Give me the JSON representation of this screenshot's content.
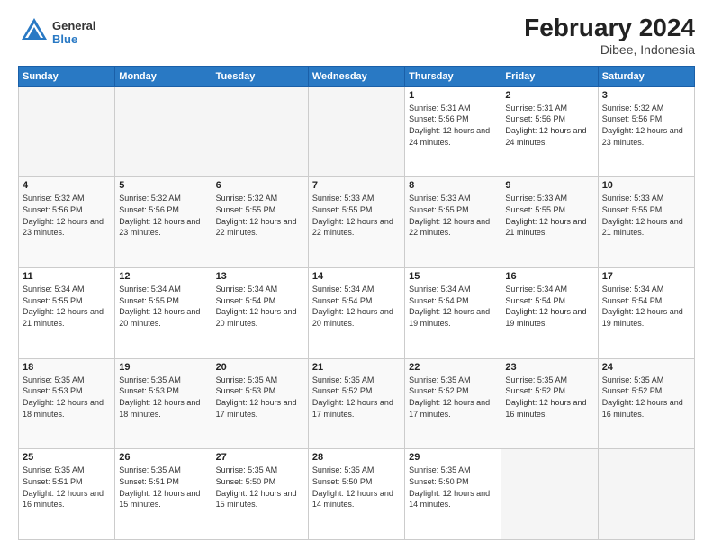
{
  "header": {
    "logo_general": "General",
    "logo_blue": "Blue",
    "month_year": "February 2024",
    "location": "Dibee, Indonesia"
  },
  "days_of_week": [
    "Sunday",
    "Monday",
    "Tuesday",
    "Wednesday",
    "Thursday",
    "Friday",
    "Saturday"
  ],
  "weeks": [
    [
      {
        "day": "",
        "sunrise": "",
        "sunset": "",
        "daylight": "",
        "empty": true
      },
      {
        "day": "",
        "sunrise": "",
        "sunset": "",
        "daylight": "",
        "empty": true
      },
      {
        "day": "",
        "sunrise": "",
        "sunset": "",
        "daylight": "",
        "empty": true
      },
      {
        "day": "",
        "sunrise": "",
        "sunset": "",
        "daylight": "",
        "empty": true
      },
      {
        "day": "1",
        "sunrise": "Sunrise: 5:31 AM",
        "sunset": "Sunset: 5:56 PM",
        "daylight": "Daylight: 12 hours and 24 minutes.",
        "empty": false
      },
      {
        "day": "2",
        "sunrise": "Sunrise: 5:31 AM",
        "sunset": "Sunset: 5:56 PM",
        "daylight": "Daylight: 12 hours and 24 minutes.",
        "empty": false
      },
      {
        "day": "3",
        "sunrise": "Sunrise: 5:32 AM",
        "sunset": "Sunset: 5:56 PM",
        "daylight": "Daylight: 12 hours and 23 minutes.",
        "empty": false
      }
    ],
    [
      {
        "day": "4",
        "sunrise": "Sunrise: 5:32 AM",
        "sunset": "Sunset: 5:56 PM",
        "daylight": "Daylight: 12 hours and 23 minutes.",
        "empty": false
      },
      {
        "day": "5",
        "sunrise": "Sunrise: 5:32 AM",
        "sunset": "Sunset: 5:56 PM",
        "daylight": "Daylight: 12 hours and 23 minutes.",
        "empty": false
      },
      {
        "day": "6",
        "sunrise": "Sunrise: 5:32 AM",
        "sunset": "Sunset: 5:55 PM",
        "daylight": "Daylight: 12 hours and 22 minutes.",
        "empty": false
      },
      {
        "day": "7",
        "sunrise": "Sunrise: 5:33 AM",
        "sunset": "Sunset: 5:55 PM",
        "daylight": "Daylight: 12 hours and 22 minutes.",
        "empty": false
      },
      {
        "day": "8",
        "sunrise": "Sunrise: 5:33 AM",
        "sunset": "Sunset: 5:55 PM",
        "daylight": "Daylight: 12 hours and 22 minutes.",
        "empty": false
      },
      {
        "day": "9",
        "sunrise": "Sunrise: 5:33 AM",
        "sunset": "Sunset: 5:55 PM",
        "daylight": "Daylight: 12 hours and 21 minutes.",
        "empty": false
      },
      {
        "day": "10",
        "sunrise": "Sunrise: 5:33 AM",
        "sunset": "Sunset: 5:55 PM",
        "daylight": "Daylight: 12 hours and 21 minutes.",
        "empty": false
      }
    ],
    [
      {
        "day": "11",
        "sunrise": "Sunrise: 5:34 AM",
        "sunset": "Sunset: 5:55 PM",
        "daylight": "Daylight: 12 hours and 21 minutes.",
        "empty": false
      },
      {
        "day": "12",
        "sunrise": "Sunrise: 5:34 AM",
        "sunset": "Sunset: 5:55 PM",
        "daylight": "Daylight: 12 hours and 20 minutes.",
        "empty": false
      },
      {
        "day": "13",
        "sunrise": "Sunrise: 5:34 AM",
        "sunset": "Sunset: 5:54 PM",
        "daylight": "Daylight: 12 hours and 20 minutes.",
        "empty": false
      },
      {
        "day": "14",
        "sunrise": "Sunrise: 5:34 AM",
        "sunset": "Sunset: 5:54 PM",
        "daylight": "Daylight: 12 hours and 20 minutes.",
        "empty": false
      },
      {
        "day": "15",
        "sunrise": "Sunrise: 5:34 AM",
        "sunset": "Sunset: 5:54 PM",
        "daylight": "Daylight: 12 hours and 19 minutes.",
        "empty": false
      },
      {
        "day": "16",
        "sunrise": "Sunrise: 5:34 AM",
        "sunset": "Sunset: 5:54 PM",
        "daylight": "Daylight: 12 hours and 19 minutes.",
        "empty": false
      },
      {
        "day": "17",
        "sunrise": "Sunrise: 5:34 AM",
        "sunset": "Sunset: 5:54 PM",
        "daylight": "Daylight: 12 hours and 19 minutes.",
        "empty": false
      }
    ],
    [
      {
        "day": "18",
        "sunrise": "Sunrise: 5:35 AM",
        "sunset": "Sunset: 5:53 PM",
        "daylight": "Daylight: 12 hours and 18 minutes.",
        "empty": false
      },
      {
        "day": "19",
        "sunrise": "Sunrise: 5:35 AM",
        "sunset": "Sunset: 5:53 PM",
        "daylight": "Daylight: 12 hours and 18 minutes.",
        "empty": false
      },
      {
        "day": "20",
        "sunrise": "Sunrise: 5:35 AM",
        "sunset": "Sunset: 5:53 PM",
        "daylight": "Daylight: 12 hours and 17 minutes.",
        "empty": false
      },
      {
        "day": "21",
        "sunrise": "Sunrise: 5:35 AM",
        "sunset": "Sunset: 5:52 PM",
        "daylight": "Daylight: 12 hours and 17 minutes.",
        "empty": false
      },
      {
        "day": "22",
        "sunrise": "Sunrise: 5:35 AM",
        "sunset": "Sunset: 5:52 PM",
        "daylight": "Daylight: 12 hours and 17 minutes.",
        "empty": false
      },
      {
        "day": "23",
        "sunrise": "Sunrise: 5:35 AM",
        "sunset": "Sunset: 5:52 PM",
        "daylight": "Daylight: 12 hours and 16 minutes.",
        "empty": false
      },
      {
        "day": "24",
        "sunrise": "Sunrise: 5:35 AM",
        "sunset": "Sunset: 5:52 PM",
        "daylight": "Daylight: 12 hours and 16 minutes.",
        "empty": false
      }
    ],
    [
      {
        "day": "25",
        "sunrise": "Sunrise: 5:35 AM",
        "sunset": "Sunset: 5:51 PM",
        "daylight": "Daylight: 12 hours and 16 minutes.",
        "empty": false
      },
      {
        "day": "26",
        "sunrise": "Sunrise: 5:35 AM",
        "sunset": "Sunset: 5:51 PM",
        "daylight": "Daylight: 12 hours and 15 minutes.",
        "empty": false
      },
      {
        "day": "27",
        "sunrise": "Sunrise: 5:35 AM",
        "sunset": "Sunset: 5:50 PM",
        "daylight": "Daylight: 12 hours and 15 minutes.",
        "empty": false
      },
      {
        "day": "28",
        "sunrise": "Sunrise: 5:35 AM",
        "sunset": "Sunset: 5:50 PM",
        "daylight": "Daylight: 12 hours and 14 minutes.",
        "empty": false
      },
      {
        "day": "29",
        "sunrise": "Sunrise: 5:35 AM",
        "sunset": "Sunset: 5:50 PM",
        "daylight": "Daylight: 12 hours and 14 minutes.",
        "empty": false
      },
      {
        "day": "",
        "sunrise": "",
        "sunset": "",
        "daylight": "",
        "empty": true
      },
      {
        "day": "",
        "sunrise": "",
        "sunset": "",
        "daylight": "",
        "empty": true
      }
    ]
  ]
}
